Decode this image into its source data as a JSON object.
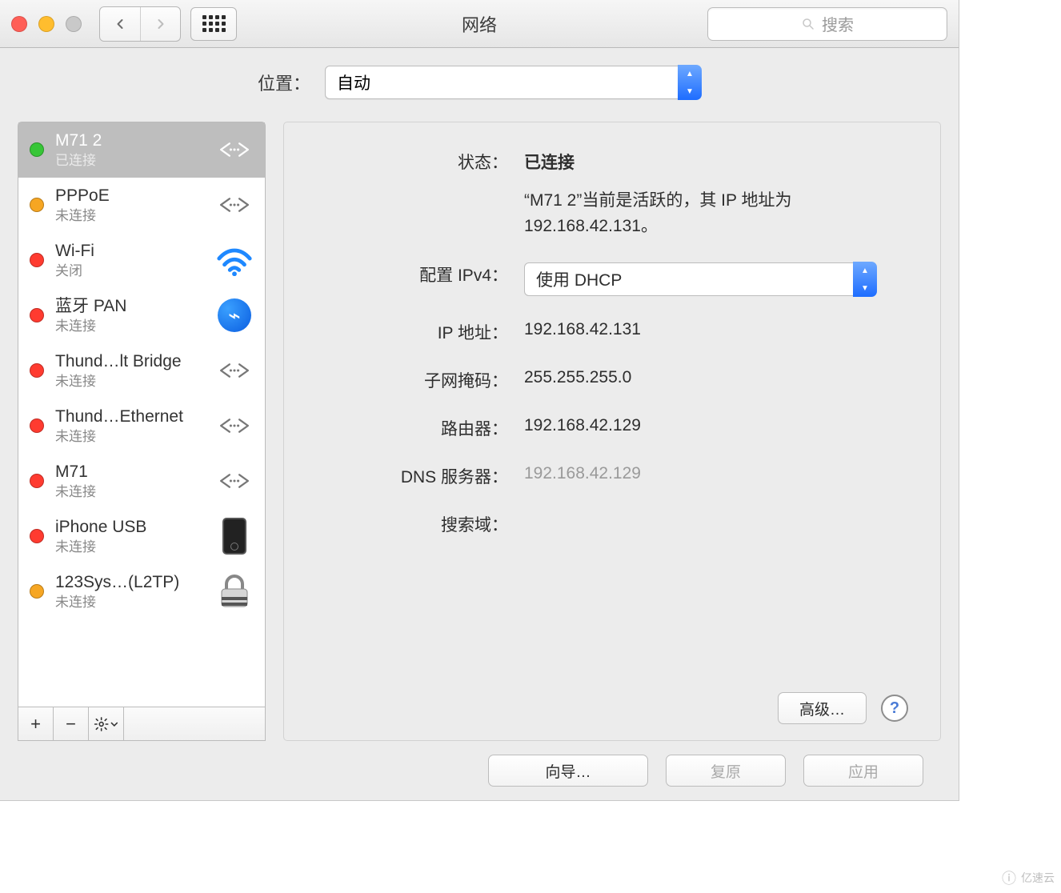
{
  "window": {
    "title": "网络"
  },
  "search": {
    "placeholder": "搜索"
  },
  "location": {
    "label": "位置：",
    "value": "自动"
  },
  "sidebar": {
    "items": [
      {
        "name": "M71 2",
        "status": "已连接",
        "dot": "green",
        "icon": "ethernet",
        "selected": true
      },
      {
        "name": "PPPoE",
        "status": "未连接",
        "dot": "orange",
        "icon": "ethernet",
        "selected": false
      },
      {
        "name": "Wi-Fi",
        "status": "关闭",
        "dot": "red",
        "icon": "wifi",
        "selected": false
      },
      {
        "name": "蓝牙 PAN",
        "status": "未连接",
        "dot": "red",
        "icon": "bluetooth",
        "selected": false
      },
      {
        "name": "Thund…lt Bridge",
        "status": "未连接",
        "dot": "red",
        "icon": "ethernet",
        "selected": false
      },
      {
        "name": "Thund…Ethernet",
        "status": "未连接",
        "dot": "red",
        "icon": "ethernet",
        "selected": false
      },
      {
        "name": "M71",
        "status": "未连接",
        "dot": "red",
        "icon": "ethernet",
        "selected": false
      },
      {
        "name": "iPhone USB",
        "status": "未连接",
        "dot": "red",
        "icon": "phone",
        "selected": false
      },
      {
        "name": "123Sys…(L2TP)",
        "status": "未连接",
        "dot": "orange",
        "icon": "lock",
        "selected": false
      }
    ]
  },
  "detail": {
    "status_label": "状态：",
    "status_value": "已连接",
    "status_desc": "“M71 2”当前是活跃的，其 IP 地址为 192.168.42.131。",
    "config_label": "配置 IPv4：",
    "config_value": "使用 DHCP",
    "ip_label": "IP 地址：",
    "ip_value": "192.168.42.131",
    "mask_label": "子网掩码：",
    "mask_value": "255.255.255.0",
    "router_label": "路由器：",
    "router_value": "192.168.42.129",
    "dns_label": "DNS 服务器：",
    "dns_value": "192.168.42.129",
    "search_label": "搜索域：",
    "search_value": "",
    "advanced_button": "高级…"
  },
  "bottom": {
    "wizard": "向导…",
    "revert": "复原",
    "apply": "应用"
  },
  "watermark": "亿速云"
}
